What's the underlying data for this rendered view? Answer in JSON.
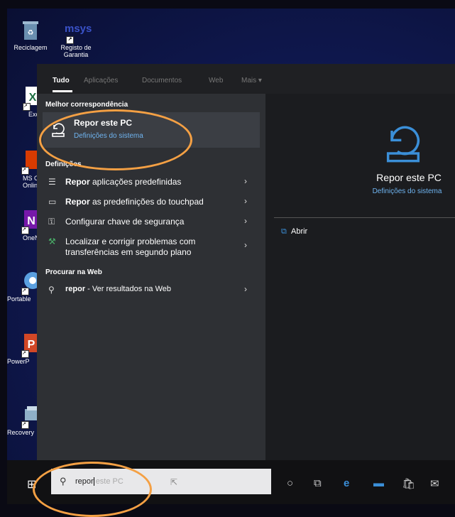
{
  "desktop": {
    "icons": [
      {
        "label": "Reciclagem"
      },
      {
        "label": "Registo de Garantia",
        "logo_text": "msys"
      },
      {
        "label": "Exce"
      },
      {
        "label": "MS Off Onlin"
      },
      {
        "label": "OneNo"
      },
      {
        "label": "Portable"
      },
      {
        "label": "PowerP"
      },
      {
        "label": "Recovery"
      }
    ]
  },
  "search": {
    "tabs": [
      "Tudo",
      "Aplicações",
      "Documentos",
      "Web",
      "Mais"
    ],
    "best_match_header": "Melhor correspondência",
    "best_match": {
      "title": "Repor este PC",
      "subtitle": "Definições do sistema"
    },
    "settings_header": "Definições",
    "settings": [
      {
        "bold": "Repor",
        "rest": " aplicações predefinidas",
        "icon": "list-icon"
      },
      {
        "bold": "Repor",
        "rest": " as predefinições do touchpad",
        "icon": "touchpad-icon"
      },
      {
        "bold": "",
        "rest": "Configurar chave de segurança",
        "icon": "key-icon"
      },
      {
        "bold": "",
        "rest": "Localizar e corrigir problemas com transferências em segundo plano",
        "icon": "troubleshoot-icon"
      }
    ],
    "web_header": "Procurar na Web",
    "web_item": {
      "bold": "repor",
      "rest": " - Ver resultados na Web"
    },
    "preview": {
      "title": "Repor este PC",
      "subtitle": "Definições do sistema",
      "open_label": "Abrir"
    }
  },
  "taskbar": {
    "search_text": "repor",
    "search_suggest": "este PC"
  },
  "colors": {
    "accent": "#3b8fd8",
    "highlight_ring": "#f4a044"
  }
}
